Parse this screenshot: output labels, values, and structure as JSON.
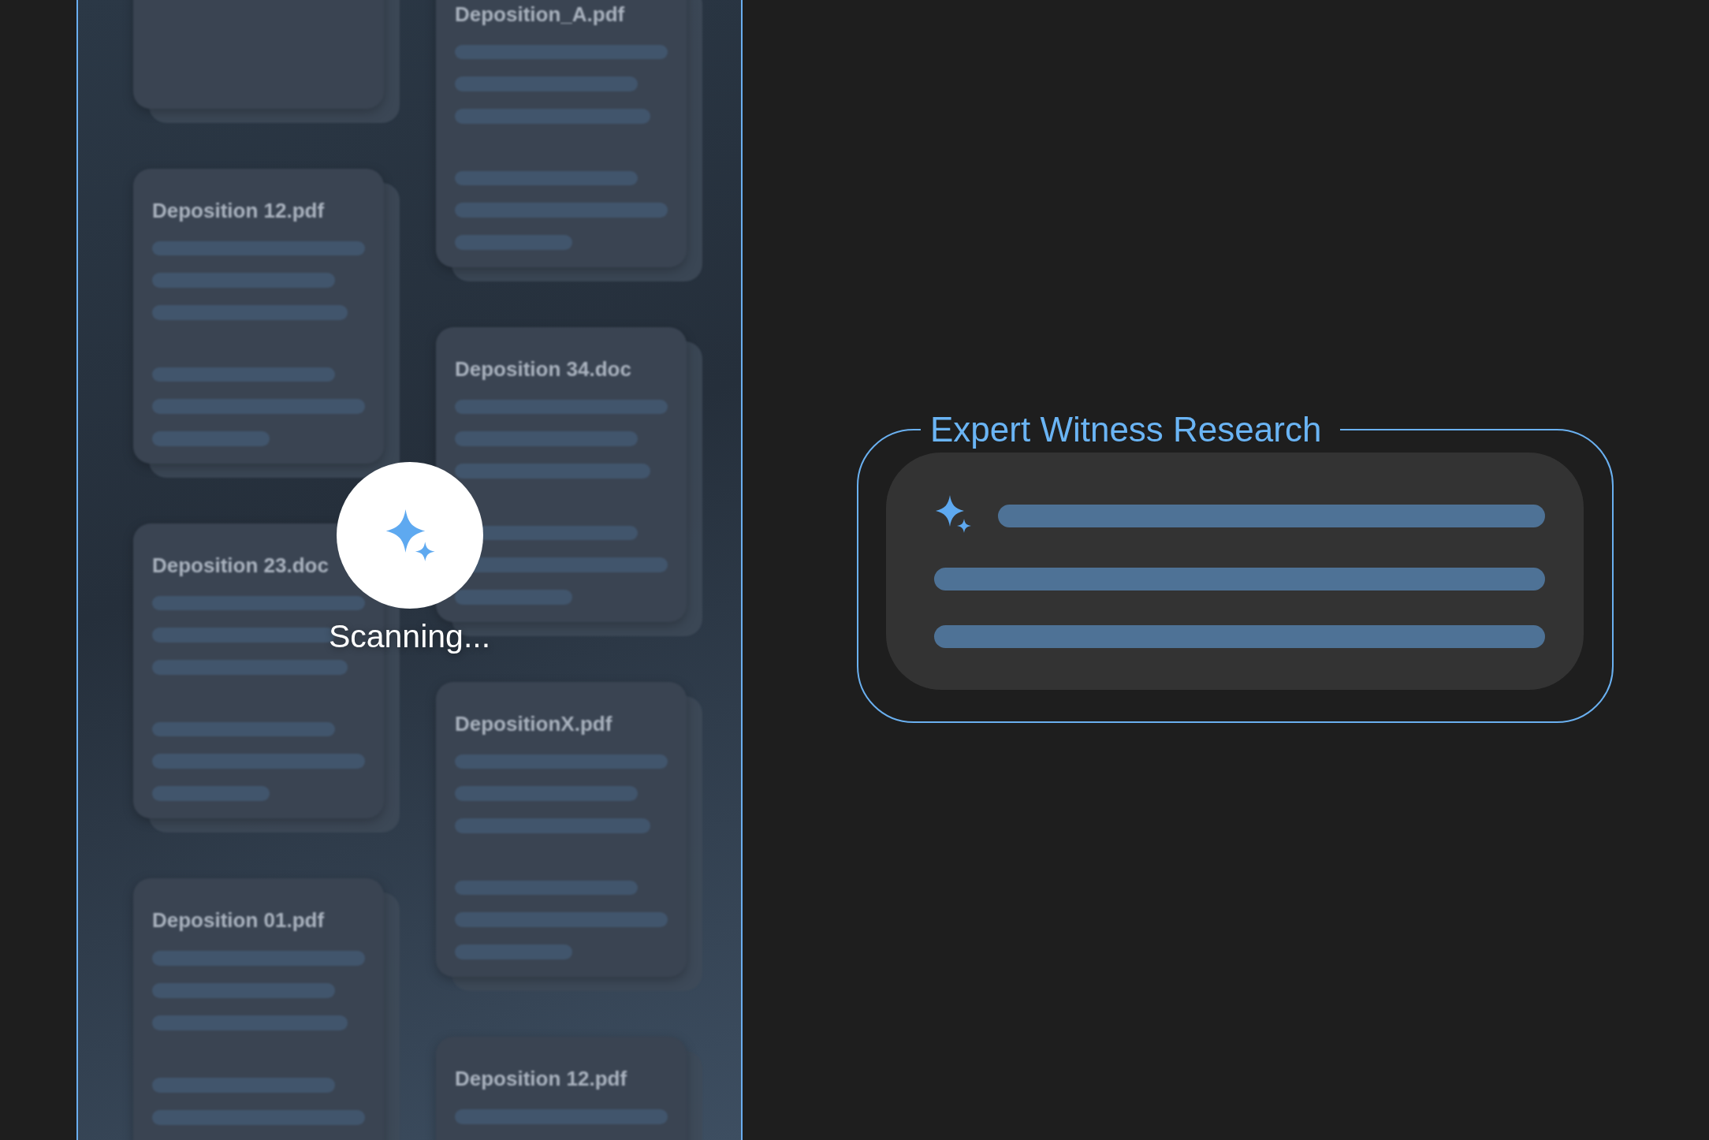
{
  "scan_panel": {
    "columns": [
      {
        "documents": [
          {
            "kind": "document"
          },
          {
            "kind": "document",
            "title": "Deposition 12.pdf"
          },
          {
            "kind": "document",
            "title": "Deposition 23.doc"
          },
          {
            "kind": "document",
            "title": "Deposition 01.pdf"
          }
        ]
      },
      {
        "documents": [
          {
            "kind": "document",
            "title": "Deposition_A.pdf"
          },
          {
            "kind": "document",
            "title": "Deposition 34.doc"
          },
          {
            "kind": "document",
            "title": "DepositionX.pdf"
          },
          {
            "kind": "document",
            "title": "Deposition 12.pdf"
          }
        ]
      }
    ],
    "status": "Scanning..."
  },
  "research_card": {
    "title": "Expert Witness Research"
  }
}
